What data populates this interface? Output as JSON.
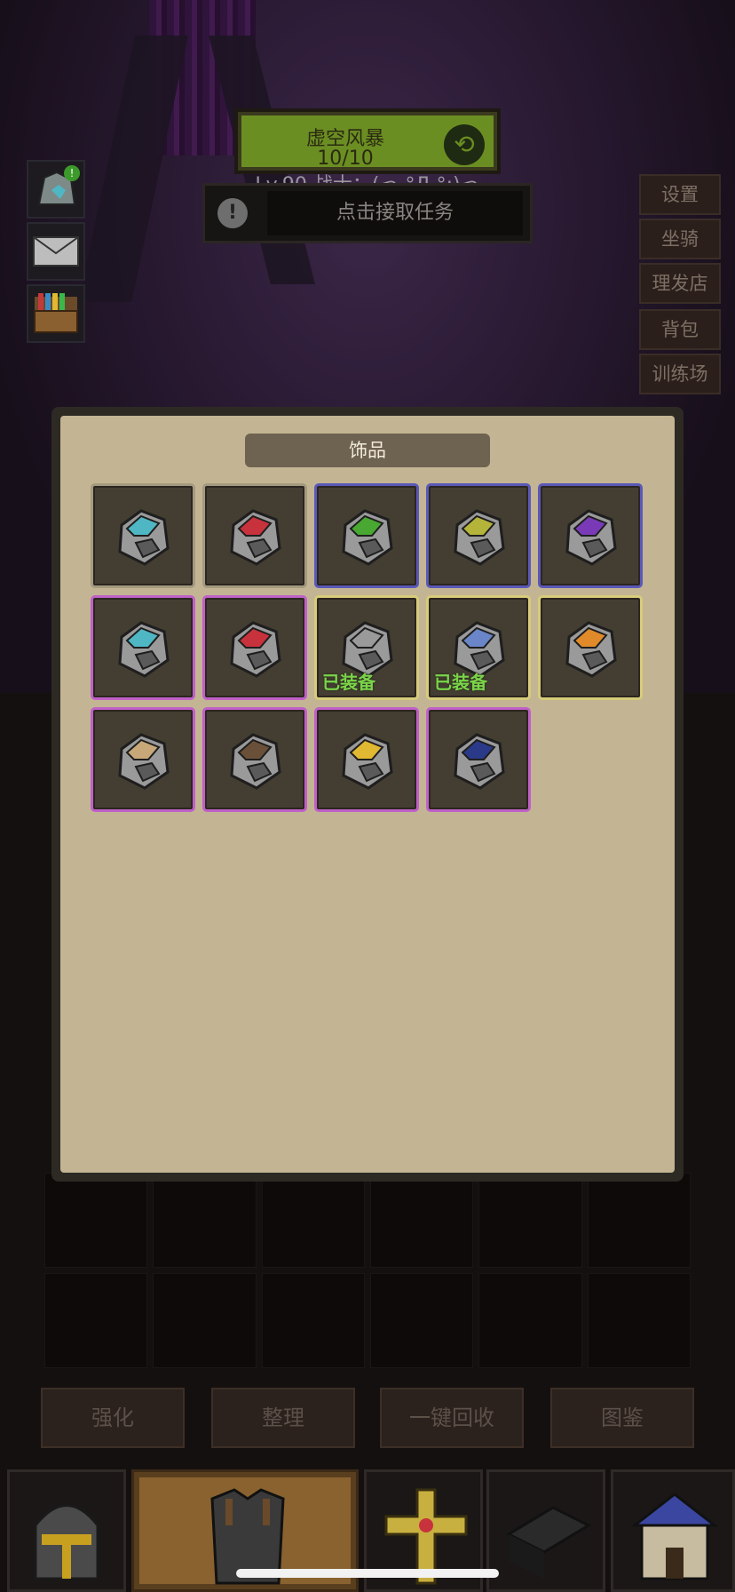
{
  "header": {
    "quest_name": "虚空风暴",
    "quest_count": "10/10",
    "player_line": "Lv.90 战士：(っ °Д °;)っ",
    "task_text": "点击接取任务"
  },
  "left_icons": [
    {
      "name": "ring-stone-icon",
      "badge": "!"
    },
    {
      "name": "mail-icon"
    },
    {
      "name": "treasure-chest-icon"
    }
  ],
  "right_menu": [
    "设置",
    "坐骑",
    "理发店",
    "背包",
    "训练场"
  ],
  "modal": {
    "title": "饰品",
    "slots": [
      {
        "rarity": "grey",
        "color": "#4fb7c4",
        "equipped": ""
      },
      {
        "rarity": "grey",
        "color": "#c8323c",
        "equipped": ""
      },
      {
        "rarity": "blue",
        "color": "#48a832",
        "equipped": ""
      },
      {
        "rarity": "blue",
        "color": "#b4b43a",
        "equipped": ""
      },
      {
        "rarity": "blue",
        "color": "#7a3ab8",
        "equipped": ""
      },
      {
        "rarity": "purple",
        "color": "#4fb7c4",
        "equipped": ""
      },
      {
        "rarity": "purple",
        "color": "#c8323c",
        "equipped": ""
      },
      {
        "rarity": "gold",
        "color": "#9a9a9a",
        "equipped": "已装备"
      },
      {
        "rarity": "gold",
        "color": "#6a86c8",
        "equipped": "已装备"
      },
      {
        "rarity": "gold",
        "color": "#e08a2a",
        "equipped": ""
      },
      {
        "rarity": "purple",
        "color": "#c8a878",
        "equipped": ""
      },
      {
        "rarity": "purple",
        "color": "#6a5038",
        "equipped": ""
      },
      {
        "rarity": "purple",
        "color": "#e0b832",
        "equipped": ""
      },
      {
        "rarity": "purple",
        "color": "#2a3a88",
        "equipped": ""
      }
    ]
  },
  "actions": [
    "强化",
    "整理",
    "一键回收",
    "图鉴"
  ],
  "tabs": [
    "helmet-icon",
    "armor-icon",
    "cross-icon",
    "book-icon",
    "shop-icon"
  ]
}
